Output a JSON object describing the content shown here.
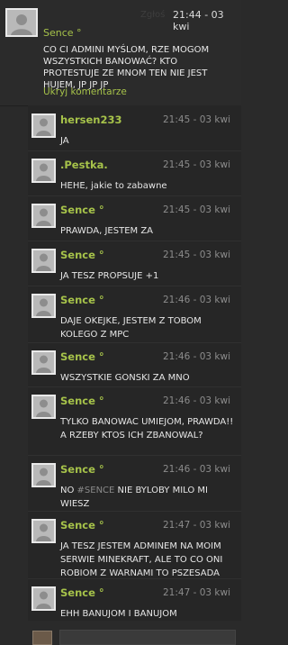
{
  "post": {
    "report_label": "Zgłoś",
    "time": "21:44 - 03 kwi",
    "author": "Sence °",
    "text": "CO CI ADMINI MYŚLOM, RZE MOGOM WSZYSTKICH BANOWAĆ? KTO PROTESTUJE ZE MNOM TEN NIE JEST HUJEM, JP JP JP",
    "hide_comments_label": "Ukryj komentarze"
  },
  "comments": [
    {
      "author": "hersen233",
      "time": "21:45 - 03 kwi",
      "text": "JA"
    },
    {
      "author": ".Pestka.",
      "time": "21:45 - 03 kwi",
      "text": "HEHE, jakie to zabawne"
    },
    {
      "author": "Sence °",
      "time": "21:45 - 03 kwi",
      "text": "PRAWDA, JESTEM ZA"
    },
    {
      "author": "Sence °",
      "time": "21:45 - 03 kwi",
      "text": "JA TESZ PROPSUJE +1"
    },
    {
      "author": "Sence °",
      "time": "21:46 - 03 kwi",
      "text": "DAJE OKEJKE, JESTEM Z TOBOM KOLEGO Z MPC"
    },
    {
      "author": "Sence °",
      "time": "21:46 - 03 kwi",
      "text": "WSZYSTKIE GONSKI ZA MNO"
    },
    {
      "author": "Sence °",
      "time": "21:46 - 03 kwi",
      "text": "TYLKO BANOWAC UMIEJOM, PRAWDA!! A RZEBY KTOS ICH ZBANOWAL?"
    },
    {
      "author": "Sence °",
      "time": "21:46 - 03 kwi",
      "text_before": "NO ",
      "tag": "#SENCE",
      "text_after": " NIE BYLOBY MILO MI WIESZ"
    },
    {
      "author": "Sence °",
      "time": "21:47 - 03 kwi",
      "text": "JA TESZ JESTEM ADMINEM NA MOIM SERWIE MINEKRAFT, ALE TO CO ONI ROBIOM Z WARNAMI TO PSZESADA"
    },
    {
      "author": "Sence °",
      "time": "21:47 - 03 kwi",
      "text": "EHH BANUJOM I BANUJOM"
    }
  ],
  "reply": {
    "placeholder": ""
  },
  "colors": {
    "accent": "#a6c24a",
    "background": "#2a2a2a",
    "comment_bg": "#262626"
  },
  "icons": {
    "avatar": "default-user-silhouette-icon"
  }
}
